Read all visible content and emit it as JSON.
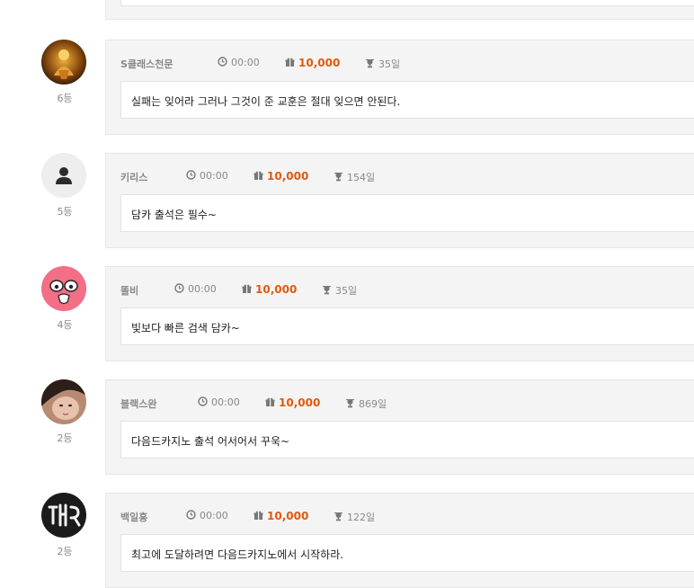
{
  "entries": [
    {
      "name": "S클래스천문",
      "time": "00:00",
      "points": "10,000",
      "days": "35일",
      "rank": "6등",
      "message": "실패는 잊어라 그러나 그것이 준 교훈은 절대 잊으면 안된다.",
      "avatar": "golden-statue-avatar"
    },
    {
      "name": "키리스",
      "time": "00:00",
      "points": "10,000",
      "days": "154일",
      "rank": "5등",
      "message": "담카 출석은 필수~",
      "avatar": "default-user-avatar"
    },
    {
      "name": "똘비",
      "time": "00:00",
      "points": "10,000",
      "days": "35일",
      "rank": "4등",
      "message": "빛보다 빠른 검색 담카~",
      "avatar": "pink-face-avatar"
    },
    {
      "name": "블랙스완",
      "time": "00:00",
      "points": "10,000",
      "days": "869일",
      "rank": "2등",
      "message": "다음드카지노 출석 어서어서 꾸욱~",
      "avatar": "photo-avatar"
    },
    {
      "name": "백일홍",
      "time": "00:00",
      "points": "10,000",
      "days": "122일",
      "rank": "2등",
      "message": "최고에 도달하려면 다음드카지노에서 시작하라.",
      "avatar": "neon-sign-avatar"
    }
  ],
  "colors": {
    "accent": "#e05a0c",
    "panel_bg": "#f4f4f4",
    "border": "#e6e6e6"
  }
}
